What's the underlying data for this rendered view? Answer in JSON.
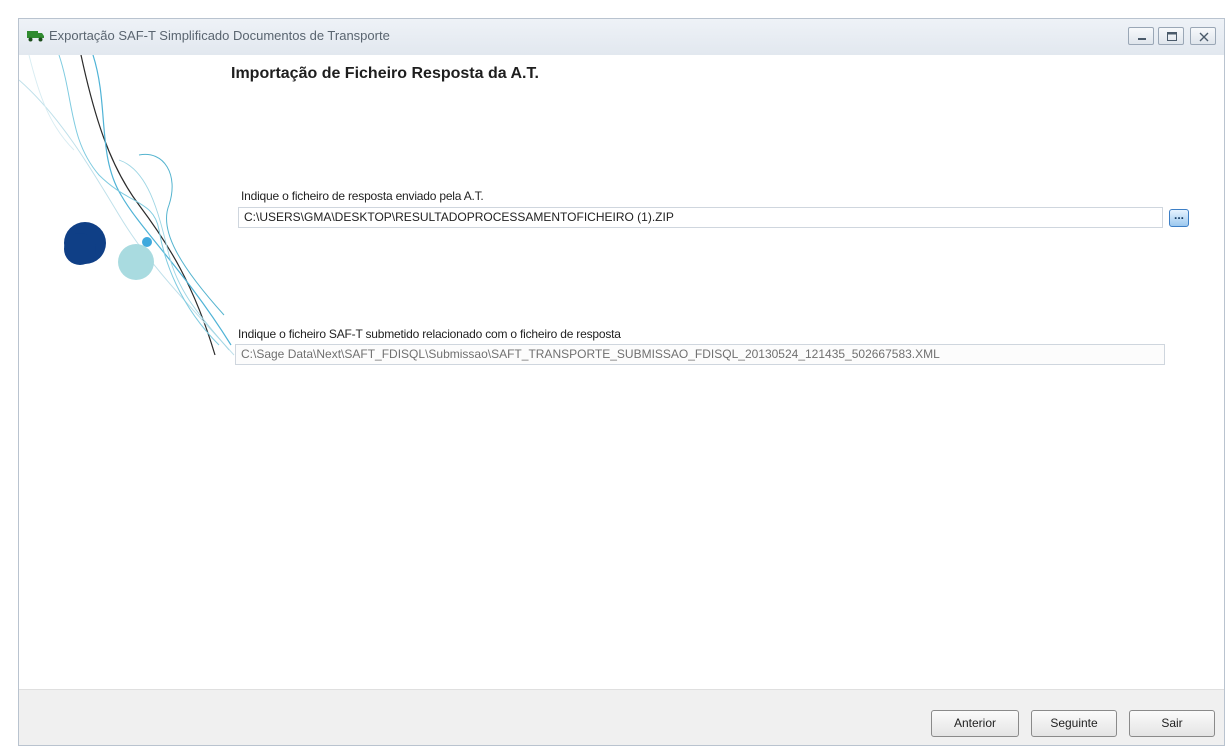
{
  "window": {
    "title": "Exportação SAF-T Simplificado Documentos de Transporte"
  },
  "page": {
    "heading": "Importação de Ficheiro Resposta da A.T."
  },
  "response_file": {
    "label": "Indique o ficheiro de resposta enviado pela A.T.",
    "value": "C:\\USERS\\GMA\\DESKTOP\\RESULTADOPROCESSAMENTOFICHEIRO (1).ZIP",
    "browse_label": "..."
  },
  "submitted_file": {
    "label": "Indique o ficheiro SAF-T submetido relacionado com o ficheiro de resposta",
    "value": "C:\\Sage Data\\Next\\SAFT_FDISQL\\Submissao\\SAFT_TRANSPORTE_SUBMISSAO_FDISQL_20130524_121435_502667583.XML"
  },
  "footer": {
    "previous_label": "Anterior",
    "next_label": "Seguinte",
    "exit_label": "Sair"
  },
  "icons": {
    "app": "truck-icon",
    "minimize": "minimize-icon",
    "maximize": "maximize-icon",
    "close": "close-icon",
    "decoration": "swirl-bubbles-decoration"
  },
  "colors": {
    "title_text": "#5a6570",
    "deco_dark_blue": "#0f3f86",
    "deco_light_teal": "#a9dbe0",
    "deco_accent": "#3fa9dd",
    "footer_bg": "#f0f0f0"
  }
}
